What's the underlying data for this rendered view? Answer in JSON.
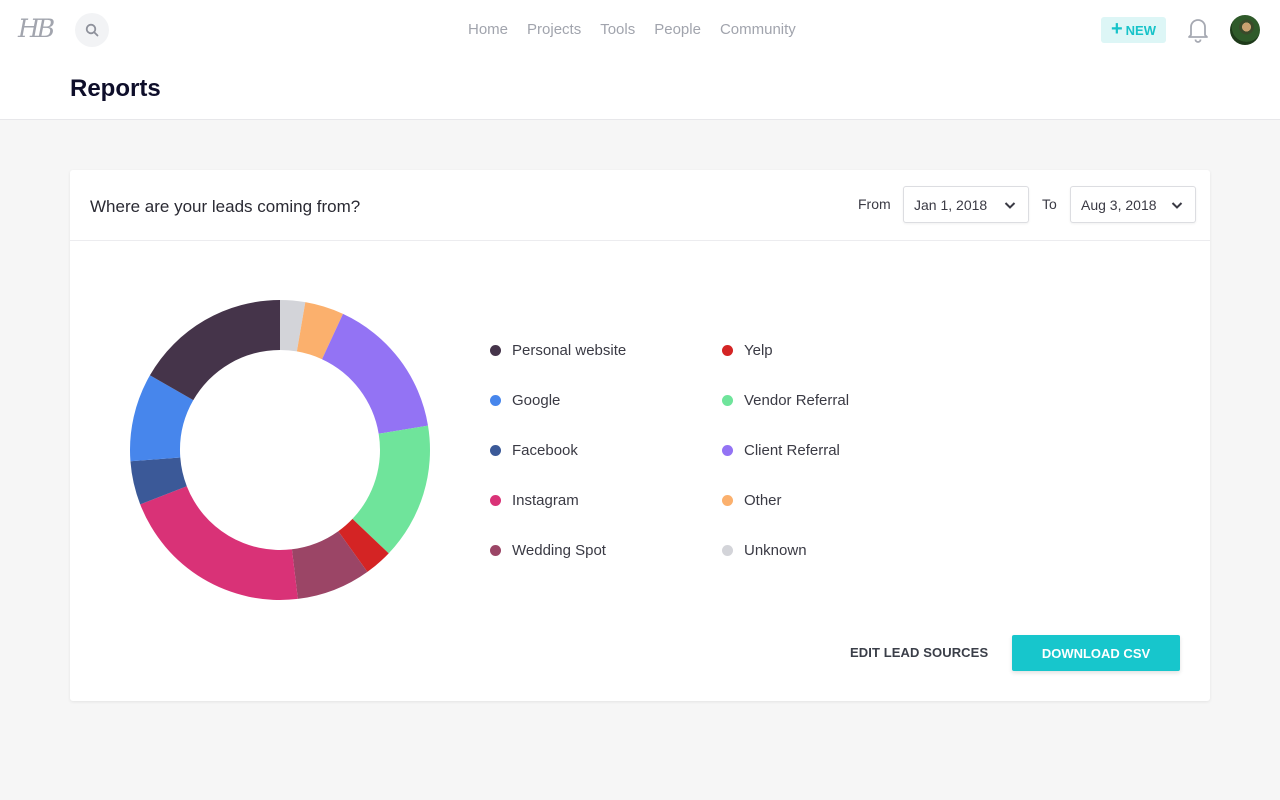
{
  "header": {
    "logo_text": "HB",
    "nav": [
      "Home",
      "Projects",
      "Tools",
      "People",
      "Community"
    ],
    "new_button_label": "NEW",
    "accent_color": "#17c6cc"
  },
  "page": {
    "title": "Reports"
  },
  "card": {
    "title": "Where are your leads coming from?",
    "from_label": "From",
    "from_value": "Jan 1, 2018",
    "to_label": "To",
    "to_value": "Aug 3, 2018",
    "edit_label": "EDIT LEAD SOURCES",
    "download_label": "DOWNLOAD CSV"
  },
  "chart_data": {
    "type": "pie",
    "variant": "donut",
    "title": "Where are your leads coming from?",
    "legend_placement": "right",
    "start_angle_deg": 0,
    "direction": "clockwise",
    "value_unit": "percent (estimated)",
    "slices": [
      {
        "label": "Unknown",
        "value": 2.7,
        "color": "#d3d4d9"
      },
      {
        "label": "Other",
        "value": 4.2,
        "color": "#fbb06d"
      },
      {
        "label": "Client Referral",
        "value": 15.5,
        "color": "#9373f4"
      },
      {
        "label": "Vendor Referral",
        "value": 14.7,
        "color": "#6fe49b"
      },
      {
        "label": "Yelp",
        "value": 3.0,
        "color": "#d42424"
      },
      {
        "label": "Wedding Spot",
        "value": 8.0,
        "color": "#9b4566"
      },
      {
        "label": "Instagram",
        "value": 21.0,
        "color": "#d93277"
      },
      {
        "label": "Facebook",
        "value": 4.7,
        "color": "#3b5998"
      },
      {
        "label": "Google",
        "value": 9.5,
        "color": "#4786ec"
      },
      {
        "label": "Personal website",
        "value": 16.7,
        "color": "#45344a"
      }
    ],
    "legend_order": [
      [
        "Personal website",
        "Google",
        "Facebook",
        "Instagram",
        "Wedding Spot"
      ],
      [
        "Yelp",
        "Vendor Referral",
        "Client Referral",
        "Other",
        "Unknown"
      ]
    ]
  }
}
